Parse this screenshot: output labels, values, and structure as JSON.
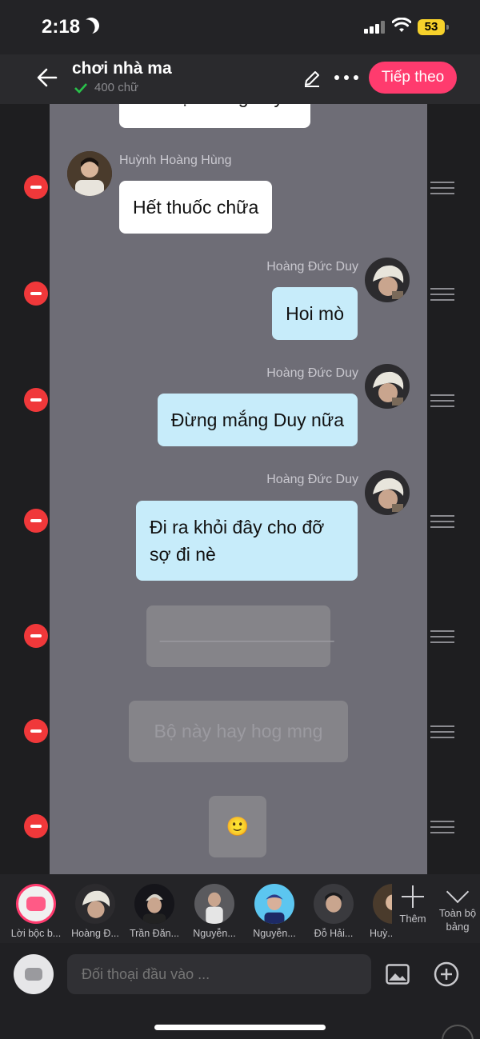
{
  "status_bar": {
    "time": "2:18",
    "battery": "53"
  },
  "header": {
    "title": "chơi nhà ma",
    "word_count": "400 chữ",
    "next_label": "Tiếp theo"
  },
  "messages": [
    {
      "type": "left",
      "text": "Tôi chịu thằng hay"
    },
    {
      "type": "left",
      "name": "Huỳnh Hoàng Hùng",
      "text": "Hết thuốc chữa"
    },
    {
      "type": "right",
      "name": "Hoàng Đức Duy",
      "text": "Hoi mò"
    },
    {
      "type": "right",
      "name": "Hoàng Đức Duy",
      "text": "Đừng mắng Duy nữa"
    },
    {
      "type": "right",
      "name": "Hoàng Đức Duy",
      "text": "Đi ra khỏi đây cho đỡ sợ đi nè"
    },
    {
      "type": "narration",
      "text": "_________________"
    },
    {
      "type": "narration",
      "text": "Bộ này hay hog mng"
    },
    {
      "type": "narration",
      "text": "🙂"
    }
  ],
  "characters": [
    {
      "label": "Lời bộc b..."
    },
    {
      "label": "Hoàng Đ..."
    },
    {
      "label": "Trần Đăn..."
    },
    {
      "label": "Nguyễn..."
    },
    {
      "label": "Nguyễn..."
    },
    {
      "label": "Đỗ Hải..."
    },
    {
      "label": "Huỳ..."
    }
  ],
  "add_label": "Thêm",
  "full_label": "Toàn bộ bảng",
  "input": {
    "placeholder": "Đối thoại đầu vào ..."
  },
  "colors": {
    "accent": "#ff3b6e",
    "my_bubble": "#c7ecfa",
    "delete": "#f0383a"
  }
}
